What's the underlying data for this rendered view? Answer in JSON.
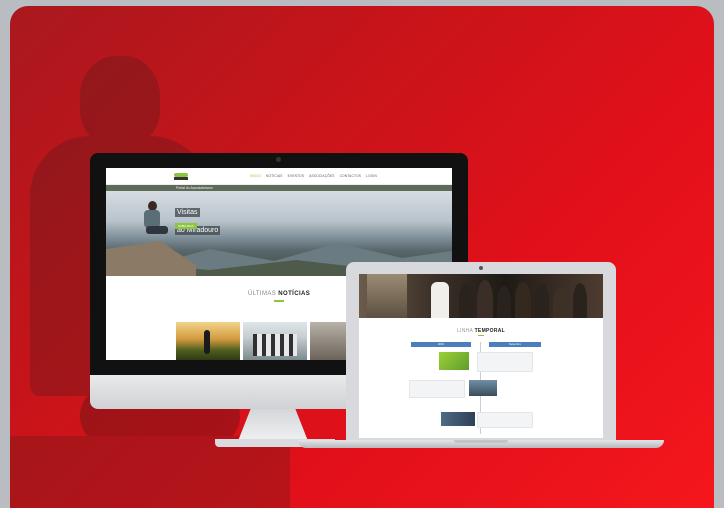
{
  "imac_site": {
    "nav": [
      "INÍCIO",
      "NOTÍCIAS",
      "EVENTOS",
      "ASSOCIAÇÕES",
      "CONTACTOS",
      "LOGIN"
    ],
    "subbar": "Portal do Associativismo",
    "hero_line1": "Visitas",
    "hero_line2": "ao Miradouro",
    "hero_button": "SAIBA MAIS",
    "section_light": "ÚLTIMAS ",
    "section_bold": "NOTÍCIAS"
  },
  "laptop_site": {
    "section_light": "LINHA ",
    "section_bold": "TEMPORAL",
    "pill_left": "2016",
    "pill_right": "Setembro"
  },
  "colors": {
    "accent_green": "#8cc63f",
    "brand_red": "#e2101a",
    "timeline_blue": "#4a7ebc"
  }
}
